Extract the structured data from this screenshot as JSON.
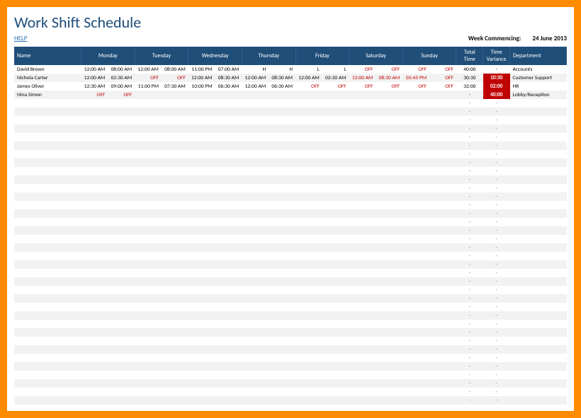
{
  "title": "Work Shift Schedule",
  "help": "HELP",
  "weekLabel": "Week Commencing:",
  "weekDate": "24 June 2013",
  "headers": {
    "name": "Name",
    "mon": "Monday",
    "tue": "Tuesday",
    "wed": "Wednesday",
    "thu": "Thursday",
    "fri": "Friday",
    "sat": "Saturday",
    "sun": "Sunday",
    "total": "Total Time",
    "variance": "Time Variance",
    "dept": "Department"
  },
  "rows": [
    {
      "name": "David Brown",
      "mon": [
        "12:00 AM",
        "08:00 AM"
      ],
      "tue": [
        "12:00 AM",
        "08:00 AM"
      ],
      "wed": [
        "11:00 PM",
        "07:00 AM"
      ],
      "thu": [
        "H",
        "H"
      ],
      "fri": [
        "L",
        "L"
      ],
      "sat": [
        "OFF",
        "OFF"
      ],
      "sun": [
        "OFF",
        "OFF"
      ],
      "satOff": true,
      "sunOff": true,
      "total": "40:00",
      "variance": "-",
      "dept": "Accounts"
    },
    {
      "name": "Nichola Carter",
      "mon": [
        "12:00 AM",
        "02:30 AM"
      ],
      "tue": [
        "OFF",
        "OFF"
      ],
      "tueOff": true,
      "wed": [
        "12:00 AM",
        "08:30 AM"
      ],
      "thu": [
        "12:00 AM",
        "08:30 AM"
      ],
      "fri": [
        "12:00 AM",
        "02:30 AM"
      ],
      "sat": [
        "12:00 AM",
        "08:30 AM"
      ],
      "sun": [
        "05:45 PM",
        "OFF"
      ],
      "satWeekend": true,
      "sunWeekend": true,
      "total": "30:30",
      "variance": "10:30",
      "varBad": true,
      "dept": "Customer Support"
    },
    {
      "name": "James Oliver",
      "mon": [
        "12:30 AM",
        "09:00 AM"
      ],
      "tue": [
        "11:00 PM",
        "07:30 AM"
      ],
      "wed": [
        "10:00 PM",
        "06:30 AM"
      ],
      "thu": [
        "12:00 AM",
        "06:30 AM"
      ],
      "fri": [
        "OFF",
        "OFF"
      ],
      "friOff": true,
      "sat": [
        "OFF",
        "OFF"
      ],
      "satOff": true,
      "sun": [
        "OFF",
        "OFF"
      ],
      "sunOff": true,
      "total": "32:00",
      "variance": "02:00",
      "varBad": true,
      "dept": "HR"
    },
    {
      "name": "Nina Simon",
      "mon": [
        "OFF",
        "OFF"
      ],
      "monOff": true,
      "tue": [
        "",
        ""
      ],
      "wed": [
        "",
        ""
      ],
      "thu": [
        "",
        ""
      ],
      "fri": [
        "",
        ""
      ],
      "sat": [
        "",
        ""
      ],
      "sun": [
        "",
        ""
      ],
      "total": "-",
      "variance": "40:00",
      "varBad": true,
      "dept": "Lobby/Reception"
    }
  ],
  "emptyRows": 36
}
